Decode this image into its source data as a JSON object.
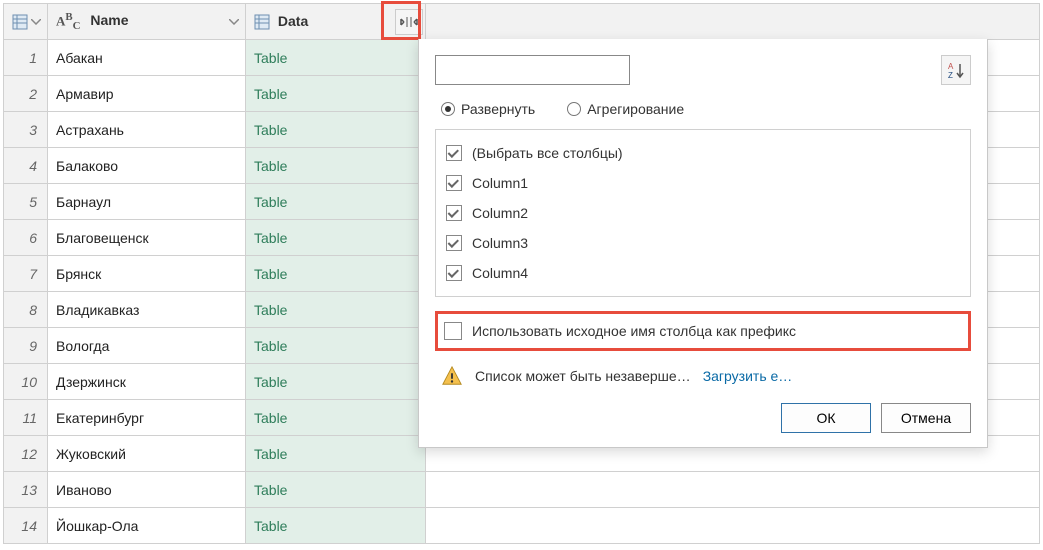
{
  "columns": {
    "name_header": "Name",
    "data_header": "Data"
  },
  "rows": [
    {
      "n": "1",
      "name": "Абакан",
      "data": "Table"
    },
    {
      "n": "2",
      "name": "Армавир",
      "data": "Table"
    },
    {
      "n": "3",
      "name": "Астрахань",
      "data": "Table"
    },
    {
      "n": "4",
      "name": "Балаково",
      "data": "Table"
    },
    {
      "n": "5",
      "name": "Барнаул",
      "data": "Table"
    },
    {
      "n": "6",
      "name": "Благовещенск",
      "data": "Table"
    },
    {
      "n": "7",
      "name": "Брянск",
      "data": "Table"
    },
    {
      "n": "8",
      "name": "Владикавказ",
      "data": "Table"
    },
    {
      "n": "9",
      "name": "Вологда",
      "data": "Table"
    },
    {
      "n": "10",
      "name": "Дзержинск",
      "data": "Table"
    },
    {
      "n": "11",
      "name": "Екатеринбург",
      "data": "Table"
    },
    {
      "n": "12",
      "name": "Жуковский",
      "data": "Table"
    },
    {
      "n": "13",
      "name": "Иваново",
      "data": "Table"
    },
    {
      "n": "14",
      "name": "Йошкар-Ола",
      "data": "Table"
    }
  ],
  "popup": {
    "radio_expand": "Развернуть",
    "radio_aggregate": "Агрегирование",
    "select_all": "(Выбрать все столбцы)",
    "col1": "Column1",
    "col2": "Column2",
    "col3": "Column3",
    "col4": "Column4",
    "use_prefix": "Использовать исходное имя столбца как префикс",
    "warning": "Список может быть незаверше…",
    "load_more": "Загрузить е…",
    "ok": "ОК",
    "cancel": "Отмена"
  }
}
